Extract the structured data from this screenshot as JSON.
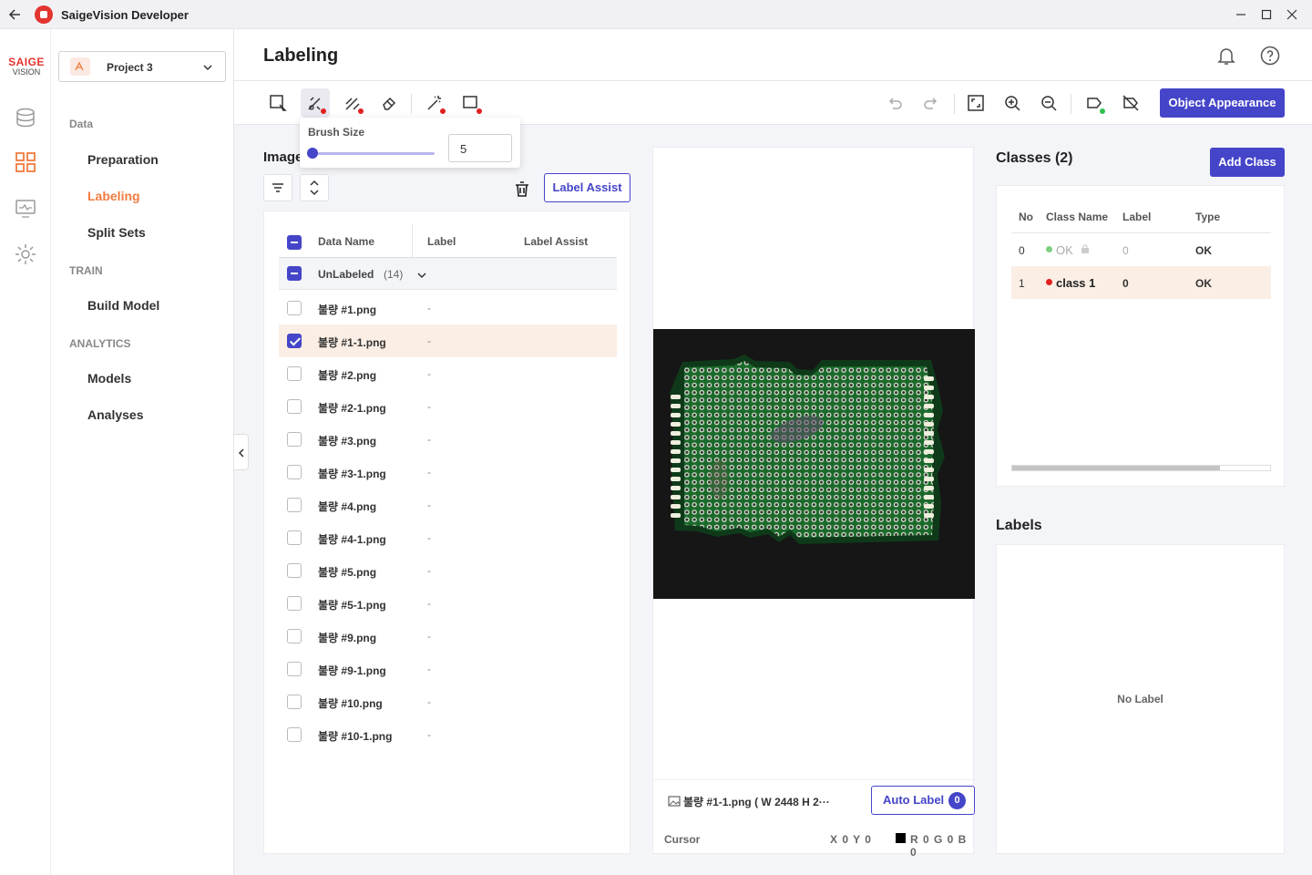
{
  "app": {
    "title": "SaigeVision Developer"
  },
  "logo": {
    "line1": "SAIGE",
    "line2": "VISION"
  },
  "project": {
    "name": "Project 3"
  },
  "nav": {
    "data_section": "Data",
    "items_data": [
      "Preparation",
      "Labeling",
      "Split Sets"
    ],
    "train_section": "TRAIN",
    "items_train": [
      "Build Model"
    ],
    "analytics_section": "ANALYTICS",
    "items_analytics": [
      "Models",
      "Analyses"
    ],
    "active": "Labeling"
  },
  "header": {
    "page_title": "Labeling"
  },
  "toolbar": {
    "object_appearance": "Object Appearance"
  },
  "brush": {
    "label": "Brush Size",
    "value": "5",
    "level": 0.03
  },
  "image_panel": {
    "title": "Image",
    "label_assist_button": "Label Assist",
    "columns": [
      "Data Name",
      "Label",
      "Label Assist"
    ],
    "group": {
      "name": "UnLabeled",
      "count": "(14)"
    },
    "rows": [
      {
        "name": "불량 #1.png",
        "label": "-",
        "checked": false
      },
      {
        "name": "불량 #1-1.png",
        "label": "-",
        "checked": true
      },
      {
        "name": "불량 #2.png",
        "label": "-",
        "checked": false
      },
      {
        "name": "불량 #2-1.png",
        "label": "-",
        "checked": false
      },
      {
        "name": "불량 #3.png",
        "label": "-",
        "checked": false
      },
      {
        "name": "불량 #3-1.png",
        "label": "-",
        "checked": false
      },
      {
        "name": "불량 #4.png",
        "label": "-",
        "checked": false
      },
      {
        "name": "불량 #4-1.png",
        "label": "-",
        "checked": false
      },
      {
        "name": "불량 #5.png",
        "label": "-",
        "checked": false
      },
      {
        "name": "불량 #5-1.png",
        "label": "-",
        "checked": false
      },
      {
        "name": "불량 #9.png",
        "label": "-",
        "checked": false
      },
      {
        "name": "불량 #9-1.png",
        "label": "-",
        "checked": false
      },
      {
        "name": "불량 #10.png",
        "label": "-",
        "checked": false
      },
      {
        "name": "불량 #10-1.png",
        "label": "-",
        "checked": false
      }
    ]
  },
  "canvas": {
    "file_info": "불량 #1-1.png ( W 2448 H 2···",
    "auto_label_button": "Auto Label",
    "auto_label_count": "0",
    "cursor_label": "Cursor",
    "cursor_xy": "X 0 Y 0",
    "cursor_rgb": "R 0 G 0 B 0"
  },
  "classes": {
    "title": "Classes (2)",
    "add_button": "Add Class",
    "columns": [
      "No",
      "Class Name",
      "Label",
      "Type"
    ],
    "rows": [
      {
        "no": "0",
        "name": "OK",
        "label": "0",
        "type": "OK",
        "color": "#7ed07e",
        "locked": true
      },
      {
        "no": "1",
        "name": "class 1",
        "label": "0",
        "type": "OK",
        "color": "#e02020",
        "locked": false
      }
    ]
  },
  "labels": {
    "title": "Labels",
    "empty_text": "No Label"
  },
  "colors": {
    "accent": "#4545c9",
    "active_nav": "#f07b3f",
    "selected_row": "#fbeee4",
    "brand_red": "#e3342f"
  }
}
